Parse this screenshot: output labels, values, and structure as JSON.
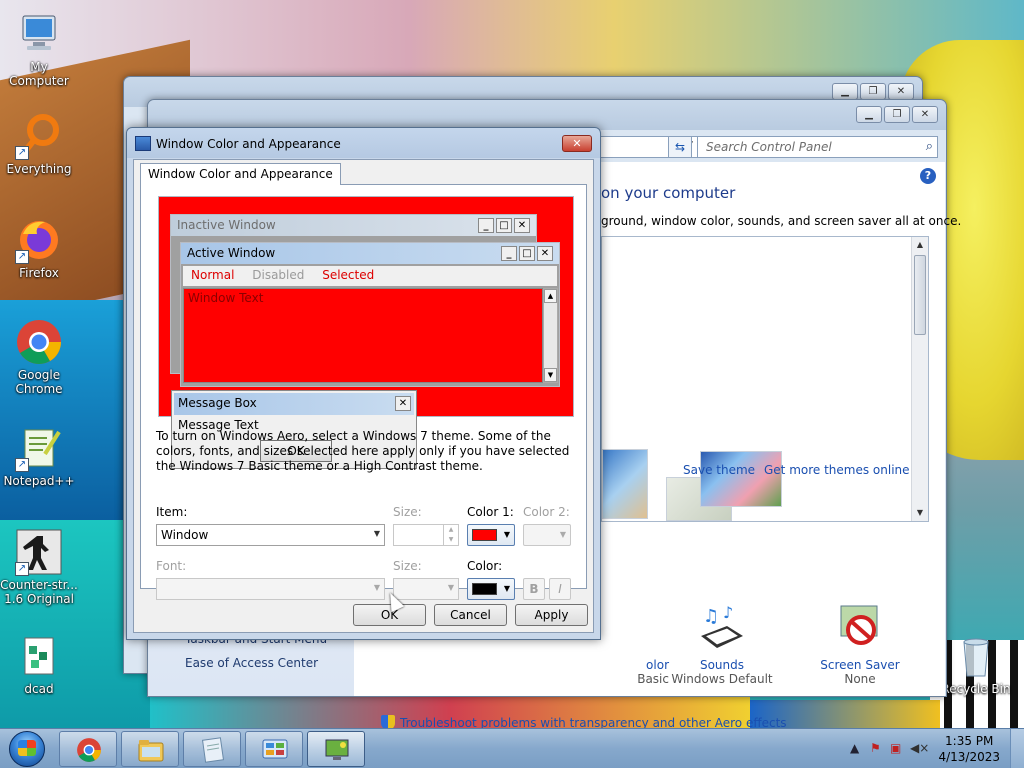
{
  "desktop": {
    "icons": [
      {
        "label": "My Computer"
      },
      {
        "label": "Everything"
      },
      {
        "label": "Firefox"
      },
      {
        "label": "Google Chrome"
      },
      {
        "label": "Notepad++"
      },
      {
        "label": "Counter-str... 1.6 Original"
      },
      {
        "label": "dcad"
      },
      {
        "label": "Recycle Bin"
      }
    ]
  },
  "control_panel": {
    "search_placeholder": "Search Control Panel",
    "heading": "on your computer",
    "subheading": "ground, window color, sounds, and screen saver all at once.",
    "save_theme": "Save theme",
    "get_more_themes": "Get more themes online",
    "left_links": [
      "Taskbar and Start Menu",
      "Ease of Access Center"
    ],
    "tiles": [
      {
        "name": "olor",
        "value": "Basic"
      },
      {
        "name": "Sounds",
        "value": "Windows Default"
      },
      {
        "name": "Screen Saver",
        "value": "None"
      }
    ],
    "troubleshoot": "Troubleshoot problems with transparency and other Aero effects"
  },
  "dialog": {
    "title": "Window Color and Appearance",
    "tab": "Window Color and Appearance",
    "preview": {
      "inactive_title": "Inactive Window",
      "active_title": "Active Window",
      "menu": [
        "Normal",
        "Disabled",
        "Selected"
      ],
      "window_text": "Window Text",
      "msgbox_title": "Message Box",
      "msgbox_text": "Message Text",
      "msgbox_ok": "OK"
    },
    "info": "To turn on Windows Aero, select a Windows 7 theme.  Some of the colors, fonts, and sizes selected here apply only if you have selected the Windows 7 Basic theme or a High Contrast theme.",
    "item_label": "Item:",
    "item_value": "Window",
    "size_label": "Size:",
    "color1_label": "Color 1:",
    "color2_label": "Color 2:",
    "font_label": "Font:",
    "font_size_label": "Size:",
    "font_color_label": "Color:",
    "bold_label": "B",
    "italic_label": "I",
    "ok": "OK",
    "cancel": "Cancel",
    "apply": "Apply",
    "color1_hex": "#ff0000",
    "font_color_hex": "#000000"
  },
  "taskbar": {
    "time": "1:35 PM",
    "date": "4/13/2023"
  }
}
